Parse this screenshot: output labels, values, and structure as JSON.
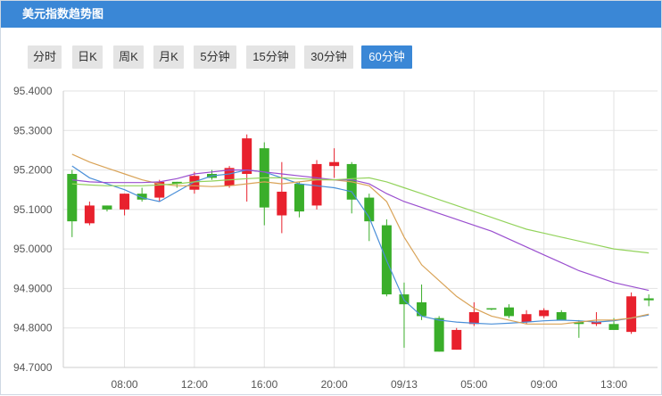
{
  "header": {
    "title": "美元指数趋势图"
  },
  "tabs": [
    {
      "label": "分时",
      "active": false
    },
    {
      "label": "日K",
      "active": false
    },
    {
      "label": "周K",
      "active": false
    },
    {
      "label": "月K",
      "active": false
    },
    {
      "label": "5分钟",
      "active": false
    },
    {
      "label": "15分钟",
      "active": false
    },
    {
      "label": "30分钟",
      "active": false
    },
    {
      "label": "60分钟",
      "active": true
    }
  ],
  "colors": {
    "up": "#e8212d",
    "down": "#3aae2a",
    "ma_blue": "#4a8fd8",
    "ma_orange": "#d9a357",
    "ma_purple": "#9a4fcf",
    "ma_green": "#93d35c"
  },
  "chart_data": {
    "type": "candlestick",
    "yticks": [
      "95.4000",
      "95.3000",
      "95.2000",
      "95.1000",
      "95.0000",
      "94.9000",
      "94.8000",
      "94.7000"
    ],
    "ylim": [
      94.7,
      95.4
    ],
    "xticks": [
      "08:00",
      "12:00",
      "16:00",
      "20:00",
      "09/13",
      "05:00",
      "09:00",
      "13:00"
    ],
    "xtick_index": [
      3,
      7,
      11,
      15,
      19,
      23,
      27,
      31
    ],
    "candles": [
      {
        "o": 95.19,
        "h": 95.2,
        "l": 95.03,
        "c": 95.07
      },
      {
        "o": 95.065,
        "h": 95.12,
        "l": 95.06,
        "c": 95.11
      },
      {
        "o": 95.11,
        "h": 95.11,
        "l": 95.095,
        "c": 95.1
      },
      {
        "o": 95.1,
        "h": 95.14,
        "l": 95.085,
        "c": 95.14
      },
      {
        "o": 95.14,
        "h": 95.155,
        "l": 95.12,
        "c": 95.125
      },
      {
        "o": 95.13,
        "h": 95.175,
        "l": 95.12,
        "c": 95.17
      },
      {
        "o": 95.17,
        "h": 95.17,
        "l": 95.155,
        "c": 95.165
      },
      {
        "o": 95.15,
        "h": 95.195,
        "l": 95.14,
        "c": 95.185
      },
      {
        "o": 95.19,
        "h": 95.2,
        "l": 95.175,
        "c": 95.18
      },
      {
        "o": 95.16,
        "h": 95.21,
        "l": 95.155,
        "c": 95.205
      },
      {
        "o": 95.19,
        "h": 95.29,
        "l": 95.12,
        "c": 95.28
      },
      {
        "o": 95.255,
        "h": 95.27,
        "l": 95.06,
        "c": 95.105
      },
      {
        "o": 95.085,
        "h": 95.22,
        "l": 95.04,
        "c": 95.145
      },
      {
        "o": 95.165,
        "h": 95.17,
        "l": 95.08,
        "c": 95.095
      },
      {
        "o": 95.11,
        "h": 95.225,
        "l": 95.1,
        "c": 95.215
      },
      {
        "o": 95.21,
        "h": 95.255,
        "l": 95.18,
        "c": 95.22
      },
      {
        "o": 95.215,
        "h": 95.22,
        "l": 95.09,
        "c": 95.125
      },
      {
        "o": 95.13,
        "h": 95.14,
        "l": 95.02,
        "c": 95.07
      },
      {
        "o": 95.06,
        "h": 95.075,
        "l": 94.88,
        "c": 94.885
      },
      {
        "o": 94.885,
        "h": 94.915,
        "l": 94.75,
        "c": 94.86
      },
      {
        "o": 94.865,
        "h": 94.91,
        "l": 94.82,
        "c": 94.83
      },
      {
        "o": 94.825,
        "h": 94.83,
        "l": 94.74,
        "c": 94.74
      },
      {
        "o": 94.745,
        "h": 94.8,
        "l": 94.745,
        "c": 94.795
      },
      {
        "o": 94.81,
        "h": 94.865,
        "l": 94.805,
        "c": 94.84
      },
      {
        "o": 94.85,
        "h": 94.85,
        "l": 94.845,
        "c": 94.848
      },
      {
        "o": 94.852,
        "h": 94.86,
        "l": 94.825,
        "c": 94.83
      },
      {
        "o": 94.815,
        "h": 94.845,
        "l": 94.81,
        "c": 94.835
      },
      {
        "o": 94.83,
        "h": 94.85,
        "l": 94.825,
        "c": 94.845
      },
      {
        "o": 94.84,
        "h": 94.845,
        "l": 94.82,
        "c": 94.82
      },
      {
        "o": 94.815,
        "h": 94.82,
        "l": 94.775,
        "c": 94.81
      },
      {
        "o": 94.81,
        "h": 94.84,
        "l": 94.805,
        "c": 94.815
      },
      {
        "o": 94.81,
        "h": 94.825,
        "l": 94.795,
        "c": 94.795
      },
      {
        "o": 94.79,
        "h": 94.89,
        "l": 94.785,
        "c": 94.88
      },
      {
        "o": 94.875,
        "h": 94.885,
        "l": 94.855,
        "c": 94.87
      }
    ],
    "ma_lines": [
      {
        "color_key": "ma_blue",
        "values": [
          95.21,
          95.18,
          95.165,
          95.15,
          95.13,
          95.12,
          95.145,
          95.17,
          95.185,
          95.19,
          95.2,
          95.195,
          95.18,
          95.165,
          95.16,
          95.155,
          95.145,
          95.08,
          94.97,
          94.87,
          94.83,
          94.82,
          94.815,
          94.812,
          94.81,
          94.812,
          94.815,
          94.818,
          94.82,
          94.818,
          94.815,
          94.818,
          94.825,
          94.833
        ]
      },
      {
        "color_key": "ma_orange",
        "values": [
          95.24,
          95.22,
          95.205,
          95.19,
          95.175,
          95.165,
          95.16,
          95.16,
          95.158,
          95.16,
          95.165,
          95.17,
          95.165,
          95.17,
          95.175,
          95.175,
          95.17,
          95.16,
          95.12,
          95.03,
          94.96,
          94.92,
          94.88,
          94.85,
          94.83,
          94.82,
          94.81,
          94.81,
          94.81,
          94.815,
          94.82,
          94.82,
          94.825,
          94.835
        ]
      },
      {
        "color_key": "ma_purple",
        "values": [
          95.175,
          95.17,
          95.168,
          95.168,
          95.168,
          95.17,
          95.178,
          95.19,
          95.195,
          95.2,
          95.2,
          95.195,
          95.19,
          95.185,
          95.18,
          95.175,
          95.175,
          95.165,
          95.14,
          95.12,
          95.105,
          95.09,
          95.075,
          95.06,
          95.045,
          95.025,
          95.005,
          94.985,
          94.965,
          94.945,
          94.93,
          94.915,
          94.905,
          94.895
        ]
      },
      {
        "color_key": "ma_green",
        "values": [
          95.165,
          95.162,
          95.16,
          95.16,
          95.16,
          95.162,
          95.165,
          95.17,
          95.172,
          95.175,
          95.178,
          95.18,
          95.18,
          95.178,
          95.176,
          95.175,
          95.178,
          95.18,
          95.17,
          95.155,
          95.14,
          95.125,
          95.11,
          95.095,
          95.08,
          95.065,
          95.05,
          95.04,
          95.03,
          95.02,
          95.01,
          95.0,
          94.995,
          94.99
        ]
      }
    ]
  }
}
